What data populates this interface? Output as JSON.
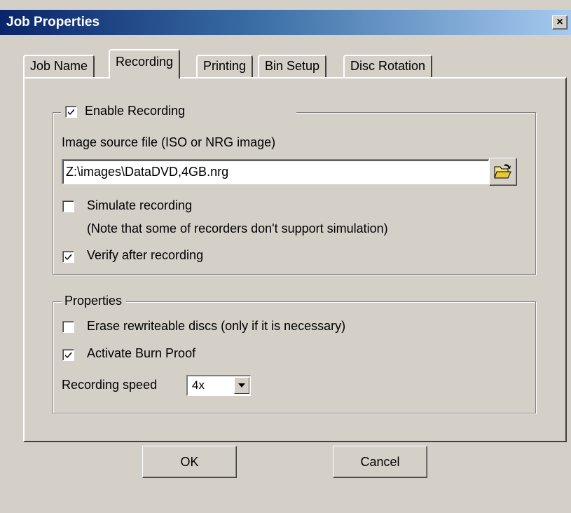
{
  "window": {
    "title": "Job Properties",
    "close_glyph": "×"
  },
  "tabs": [
    {
      "label": "Job Name",
      "active": false
    },
    {
      "label": "Recording",
      "active": true
    },
    {
      "label": "Printing",
      "active": false
    },
    {
      "label": "Bin Setup",
      "active": false
    },
    {
      "label": "Disc Rotation",
      "active": false
    }
  ],
  "recording_group": {
    "legend": "Enable Recording",
    "enabled": true,
    "image_source_label": "Image source file (ISO or NRG image)",
    "image_source_value": "Z:\\images\\DataDVD,4GB.nrg",
    "browse_icon": "folder-open-icon",
    "simulate_label": "Simulate recording",
    "simulate_checked": false,
    "simulate_note": "(Note that some of recorders don't support simulation)",
    "verify_label": "Verify after recording",
    "verify_checked": true
  },
  "properties_group": {
    "legend": "Properties",
    "erase_label": "Erase rewriteable discs (only if it is necessary)",
    "erase_checked": false,
    "burnproof_label": "Activate Burn Proof",
    "burnproof_checked": true,
    "speed_label": "Recording speed",
    "speed_value": "4x"
  },
  "buttons": {
    "ok_label": "OK",
    "cancel_label": "Cancel"
  }
}
